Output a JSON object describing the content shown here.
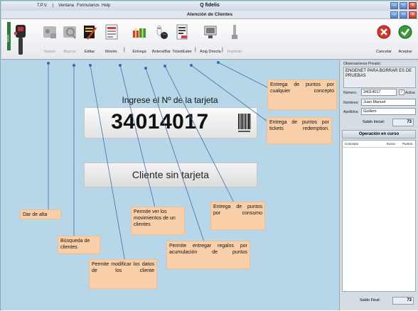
{
  "menubar": {
    "items": [
      "T.P.V.",
      "|",
      "Ventana",
      "Formularios",
      "Help"
    ],
    "app_title": "Q fidelis"
  },
  "window": {
    "title": "Atención de Clientes"
  },
  "toolbar": {
    "buttons": [
      {
        "label": "Nuevo",
        "icon": "new-card-icon",
        "enabled": false
      },
      {
        "label": "Buscar",
        "icon": "search-card-icon",
        "enabled": false
      },
      {
        "label": "Editar",
        "icon": "edit-icon",
        "enabled": true
      },
      {
        "label": "Movim.",
        "icon": "movements-icon",
        "enabled": true
      },
      {
        "label": "Entrega",
        "icon": "gift-icon",
        "enabled": true
      },
      {
        "label": "Bolera/Bar",
        "icon": "bowling-icon",
        "enabled": true
      },
      {
        "label": "TicketEater",
        "icon": "ticket-icon",
        "enabled": true
      },
      {
        "label": "Asig Directa",
        "icon": "assign-icon",
        "enabled": true
      },
      {
        "label": "Importar",
        "icon": "import-icon",
        "enabled": false
      }
    ],
    "separators": [
      "|",
      "|",
      "|",
      "|"
    ],
    "cancel_label": "Cancelar",
    "accept_label": "Aceptar"
  },
  "main": {
    "prompt": "Ingrese el Nº de la tarjeta",
    "card_number": "34014017",
    "no_card_button": "Cliente sin tarjeta"
  },
  "callouts": {
    "puntos_concepto": "Entrega de puntos por cualquier concepto",
    "puntos_tickets": "Entrega de puntos por tickets redemption.",
    "alta": "Dar de alta",
    "busqueda": "Búsqueda de clientes",
    "modificar": "Permite modificar los datos de los cliente",
    "movimientos": "Permite ver los movimientos de un clientes",
    "regalos": "Permite entregar regalos por acumulación de puntos",
    "consumo": "Entrega de puntos por consumo"
  },
  "side": {
    "obs_label": "Observaciones Privado:",
    "obs_text": "ENGENET PARA BORRAR ES DE PRUEBAS",
    "numero_label": "Número:",
    "numero_value": "34014017",
    "activa_label": "Activa",
    "activa_checked": true,
    "nombres_label": "Nombres:",
    "nombres_value": "Juan Manuel",
    "apellidos_label": "Apellidos:",
    "apellidos_value": "Guillem",
    "saldo_inicial_label": "Saldo Inicial:",
    "saldo_inicial_value": "73",
    "operacion_title": "Operación en curso",
    "col_concepto": "Concepto",
    "col_euros": "Euros",
    "col_puntos": "Puntos",
    "saldo_final_label": "Saldo Final:",
    "saldo_final_value": "73"
  },
  "colors": {
    "background": "#b7d7e8",
    "callout": "#f8cfa8",
    "cancel": "#d8322a",
    "accept": "#3a9a3a"
  }
}
